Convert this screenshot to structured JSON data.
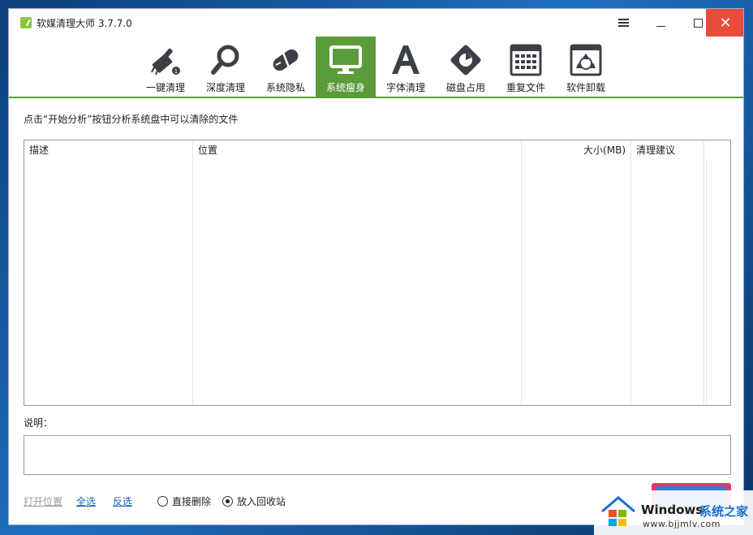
{
  "window": {
    "title": "软媒清理大师 3.7.7.0",
    "close_glyph": "✕"
  },
  "toolbar": {
    "items": [
      {
        "label": "一键清理",
        "icon": "brush-icon"
      },
      {
        "label": "深度清理",
        "icon": "magnifier-icon"
      },
      {
        "label": "系统隐私",
        "icon": "capsule-icon"
      },
      {
        "label": "系统瘦身",
        "icon": "monitor-icon",
        "active": true
      },
      {
        "label": "字体清理",
        "icon": "font-a-icon"
      },
      {
        "label": "磁盘占用",
        "icon": "disk-pie-icon"
      },
      {
        "label": "重复文件",
        "icon": "grid-file-icon"
      },
      {
        "label": "软件卸载",
        "icon": "recycle-bin-icon"
      }
    ],
    "active_color": "#5b9b3a"
  },
  "main": {
    "hint": "点击“开始分析”按钮分析系统盘中可以清除的文件",
    "table": {
      "columns": [
        "描述",
        "位置",
        "大小(MB)",
        "清理建议"
      ],
      "rows": []
    },
    "description_label": "说明：",
    "description_text": ""
  },
  "footer": {
    "open_location": "打开位置",
    "select_all": "全选",
    "invert_selection": "反选",
    "delete_mode_options": [
      {
        "label": "直接删除",
        "checked": false
      },
      {
        "label": "放入回收站",
        "checked": true
      }
    ]
  },
  "watermark": {
    "brand": "Windows",
    "brand_cn": "系统之家",
    "url": "www.bjjmlv.com"
  }
}
